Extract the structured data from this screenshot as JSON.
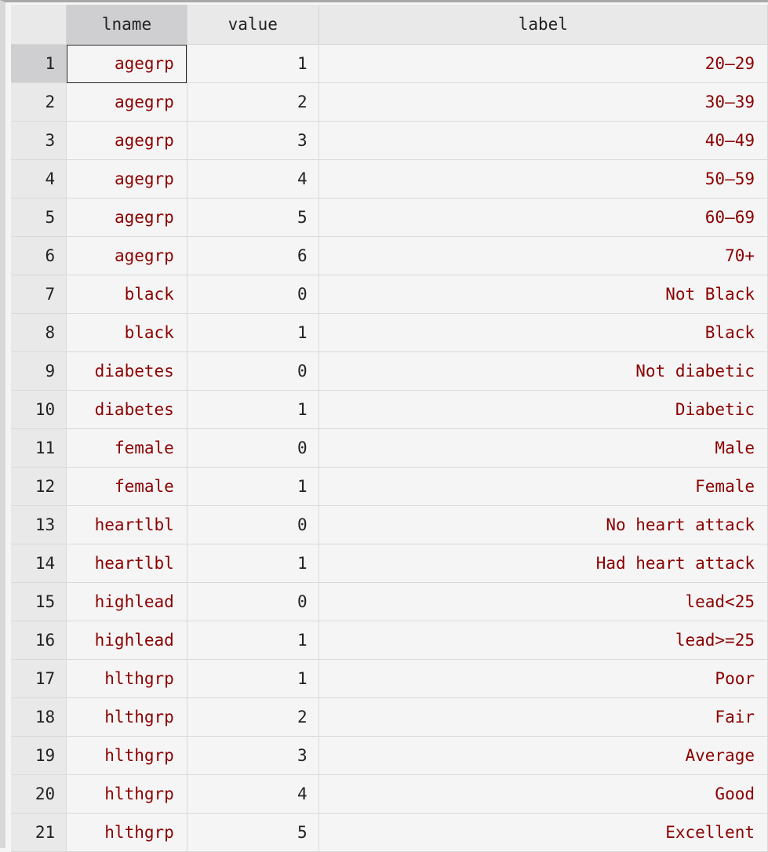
{
  "columns": [
    "lname",
    "value",
    "label"
  ],
  "colors": {
    "string_text": "#8b0000",
    "numeric_text": "#222222",
    "header_bg": "#e9e9e9",
    "selected_bg": "#cfcfd2"
  },
  "selected_cell": {
    "row": 1,
    "column": "lname"
  },
  "rows": [
    {
      "n": "1",
      "lname": "agegrp",
      "value": "1",
      "label": "20–29"
    },
    {
      "n": "2",
      "lname": "agegrp",
      "value": "2",
      "label": "30–39"
    },
    {
      "n": "3",
      "lname": "agegrp",
      "value": "3",
      "label": "40–49"
    },
    {
      "n": "4",
      "lname": "agegrp",
      "value": "4",
      "label": "50–59"
    },
    {
      "n": "5",
      "lname": "agegrp",
      "value": "5",
      "label": "60–69"
    },
    {
      "n": "6",
      "lname": "agegrp",
      "value": "6",
      "label": "70+"
    },
    {
      "n": "7",
      "lname": "black",
      "value": "0",
      "label": "Not Black"
    },
    {
      "n": "8",
      "lname": "black",
      "value": "1",
      "label": "Black"
    },
    {
      "n": "9",
      "lname": "diabetes",
      "value": "0",
      "label": "Not diabetic"
    },
    {
      "n": "10",
      "lname": "diabetes",
      "value": "1",
      "label": "Diabetic"
    },
    {
      "n": "11",
      "lname": "female",
      "value": "0",
      "label": "Male"
    },
    {
      "n": "12",
      "lname": "female",
      "value": "1",
      "label": "Female"
    },
    {
      "n": "13",
      "lname": "heartlbl",
      "value": "0",
      "label": "No heart attack"
    },
    {
      "n": "14",
      "lname": "heartlbl",
      "value": "1",
      "label": "Had heart attack"
    },
    {
      "n": "15",
      "lname": "highlead",
      "value": "0",
      "label": "lead<25"
    },
    {
      "n": "16",
      "lname": "highlead",
      "value": "1",
      "label": "lead>=25"
    },
    {
      "n": "17",
      "lname": "hlthgrp",
      "value": "1",
      "label": "Poor"
    },
    {
      "n": "18",
      "lname": "hlthgrp",
      "value": "2",
      "label": "Fair"
    },
    {
      "n": "19",
      "lname": "hlthgrp",
      "value": "3",
      "label": "Average"
    },
    {
      "n": "20",
      "lname": "hlthgrp",
      "value": "4",
      "label": "Good"
    },
    {
      "n": "21",
      "lname": "hlthgrp",
      "value": "5",
      "label": "Excellent"
    }
  ]
}
